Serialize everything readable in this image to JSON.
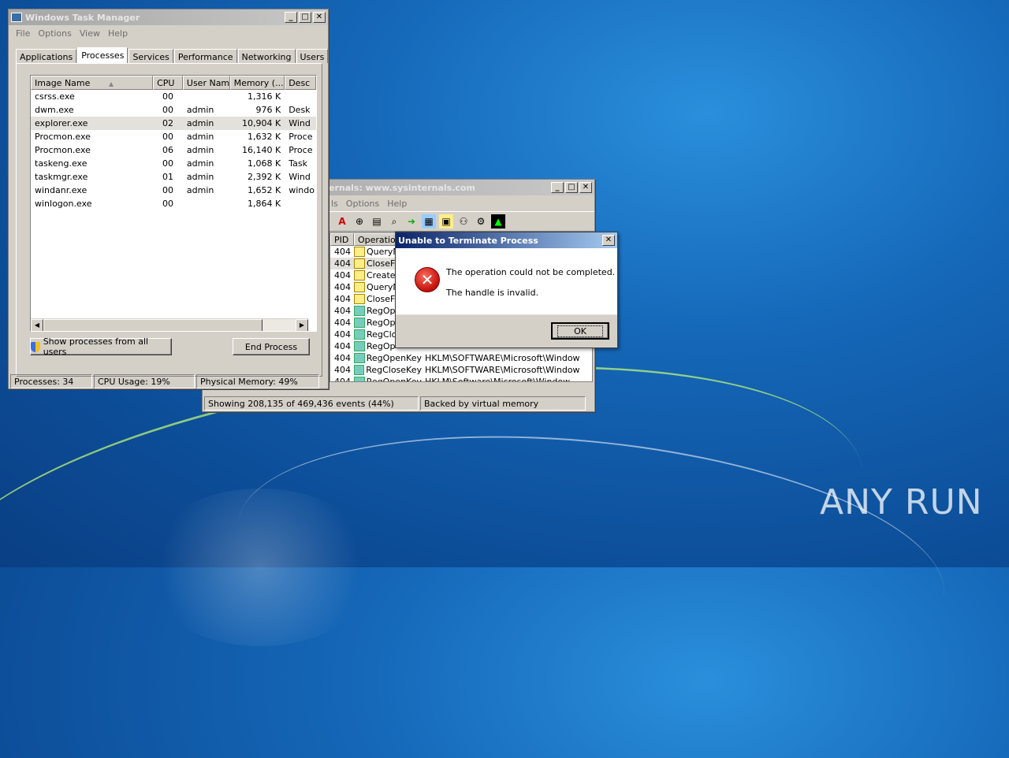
{
  "task_manager": {
    "title": "Windows Task Manager",
    "menu": [
      "File",
      "Options",
      "View",
      "Help"
    ],
    "tabs": [
      "Applications",
      "Processes",
      "Services",
      "Performance",
      "Networking",
      "Users"
    ],
    "selected_tab": "Processes",
    "columns": [
      "Image Name",
      "CPU",
      "User Name",
      "Memory (...",
      "Desc"
    ],
    "processes": [
      {
        "name": "csrss.exe",
        "cpu": "00",
        "user": "",
        "memory": "1,316 K",
        "desc": ""
      },
      {
        "name": "dwm.exe",
        "cpu": "00",
        "user": "admin",
        "memory": "976 K",
        "desc": "Desk"
      },
      {
        "name": "explorer.exe",
        "cpu": "02",
        "user": "admin",
        "memory": "10,904 K",
        "desc": "Wind"
      },
      {
        "name": "Procmon.exe",
        "cpu": "00",
        "user": "admin",
        "memory": "1,632 K",
        "desc": "Proce"
      },
      {
        "name": "Procmon.exe",
        "cpu": "06",
        "user": "admin",
        "memory": "16,140 K",
        "desc": "Proce"
      },
      {
        "name": "taskeng.exe",
        "cpu": "00",
        "user": "admin",
        "memory": "1,068 K",
        "desc": "Task"
      },
      {
        "name": "taskmgr.exe",
        "cpu": "01",
        "user": "admin",
        "memory": "2,392 K",
        "desc": "Wind"
      },
      {
        "name": "windanr.exe",
        "cpu": "00",
        "user": "admin",
        "memory": "1,652 K",
        "desc": "windo"
      },
      {
        "name": "winlogon.exe",
        "cpu": "00",
        "user": "",
        "memory": "1,864 K",
        "desc": ""
      }
    ],
    "show_all_label": "Show processes from all users",
    "end_process_label": "End Process",
    "status": {
      "processes": "Processes: 34",
      "cpu": "CPU Usage: 19%",
      "memory": "Physical Memory: 49%"
    }
  },
  "procmon": {
    "title": "ernals: www.sysinternals.com",
    "menu": [
      "ls",
      "Options",
      "Help"
    ],
    "columns": [
      "PID",
      "Operation"
    ],
    "rows": [
      {
        "pid": "404",
        "op": "QueryN",
        "path": ""
      },
      {
        "pid": "404",
        "op": "CloseFi",
        "path": ""
      },
      {
        "pid": "404",
        "op": "CreateF",
        "path": ""
      },
      {
        "pid": "404",
        "op": "QueryN",
        "path": ""
      },
      {
        "pid": "404",
        "op": "CloseFi",
        "path": ""
      },
      {
        "pid": "404",
        "op": "RegOp",
        "path": ""
      },
      {
        "pid": "404",
        "op": "RegOp",
        "path": ""
      },
      {
        "pid": "404",
        "op": "RegClo",
        "path": ""
      },
      {
        "pid": "404",
        "op": "RegOp",
        "path": ""
      },
      {
        "pid": "404",
        "op": "RegOpenKey",
        "path": "HKLM\\SOFTWARE\\Microsoft\\Window"
      },
      {
        "pid": "404",
        "op": "RegCloseKey",
        "path": "HKLM\\SOFTWARE\\Microsoft\\Window"
      },
      {
        "pid": "404",
        "op": "RegOpenKey",
        "path": "HKLM\\Software\\Microsoft\\Window"
      }
    ],
    "status": {
      "events": "Showing 208,135 of 469,436 events (44%)",
      "memory": "Backed by virtual memory"
    }
  },
  "dialog": {
    "title": "Unable to Terminate Process",
    "message": "The operation could not be completed.",
    "detail": "The handle is invalid.",
    "ok_label": "OK"
  },
  "watermark": "ANY RUN"
}
